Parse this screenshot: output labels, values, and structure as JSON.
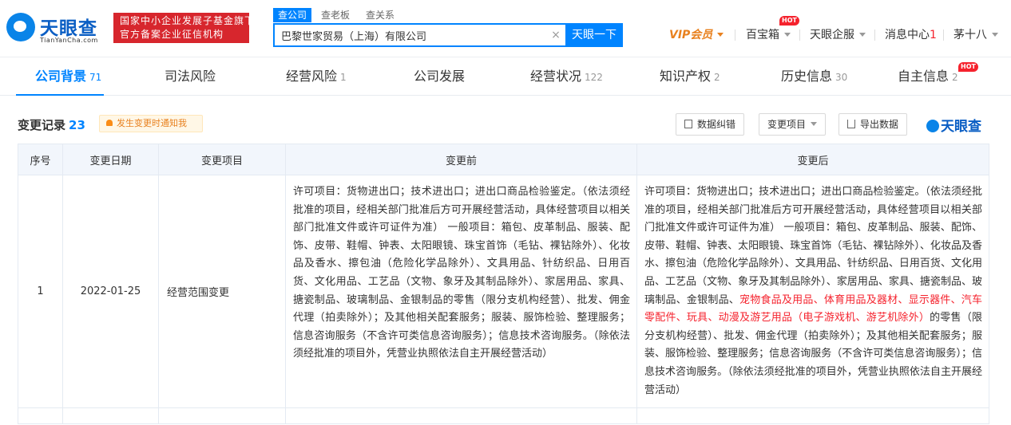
{
  "brand": {
    "name": "天眼查",
    "domain": "TianYanCha.com",
    "badge_line1": "国家中小企业发展子基金旗下",
    "badge_line2": "官方备案企业征信机构"
  },
  "search": {
    "tabs": [
      "查公司",
      "查老板",
      "查关系"
    ],
    "value": "巴黎世家贸易（上海）有限公司",
    "clear": "×",
    "button": "天眼一下"
  },
  "topnav": {
    "vip": "VIP会员",
    "treasure": "百宝箱",
    "enterprise": "天眼企服",
    "messages": "消息中心",
    "messages_count": "1",
    "user": "茅十八",
    "hot": "HOT"
  },
  "category_tabs": [
    {
      "label": "公司背景",
      "count": "71"
    },
    {
      "label": "司法风险",
      "count": ""
    },
    {
      "label": "经营风险",
      "count": "1"
    },
    {
      "label": "公司发展",
      "count": ""
    },
    {
      "label": "经营状况",
      "count": "122"
    },
    {
      "label": "知识产权",
      "count": "2"
    },
    {
      "label": "历史信息",
      "count": "30"
    },
    {
      "label": "自主信息",
      "count": "2"
    }
  ],
  "section": {
    "title": "变更记录",
    "count": "23",
    "notify": "发生变更时通知我",
    "btn_correct": "数据纠错",
    "btn_filter": "变更项目",
    "btn_export": "导出数据",
    "brand": "天眼查"
  },
  "table": {
    "headers": [
      "序号",
      "变更日期",
      "变更项目",
      "变更前",
      "变更后"
    ],
    "rows": [
      {
        "index": "1",
        "date": "2022-01-25",
        "item": "经营范围变更",
        "before": "许可项目：货物进出口；技术进出口；进出口商品检验鉴定。（依法须经批准的项目，经相关部门批准后方可开展经营活动，具体经营项目以相关部门批准文件或许可证件为准） 一般项目：箱包、皮革制品、服装、配饰、皮带、鞋帽、钟表、太阳眼镜、珠宝首饰（毛钻、裸钻除外）、化妆品及香水、擦包油（危险化学品除外）、文具用品、针纺织品、日用百货、文化用品、工艺品（文物、象牙及其制品除外）、家居用品、家具、搪瓷制品、玻璃制品、金银制品的零售（限分支机构经营）、批发、佣金代理（拍卖除外）；及其他相关配套服务；服装、服饰检验、整理服务；信息咨询服务（不含许可类信息咨询服务）；信息技术咨询服务。（除依法须经批准的项目外，凭营业执照依法自主开展经营活动）",
        "after_pre": "许可项目：货物进出口；技术进出口；进出口商品检验鉴定。（依法须经批准的项目，经相关部门批准后方可开展经营活动，具体经营项目以相关部门批准文件或许可证件为准） 一般项目：箱包、皮革制品、服装、配饰、皮带、鞋帽、钟表、太阳眼镜、珠宝首饰（毛钻、裸钻除外）、化妆品及香水、擦包油（危险化学品除外）、文具用品、针纺织品、日用百货、文化用品、工艺品（文物、象牙及其制品除外）、家居用品、家具、搪瓷制品、玻璃制品、金银制品、",
        "after_highlight": "宠物食品及用品、体育用品及器材、显示器件、汽车零配件、玩具、动漫及游艺用品（电子游戏机、游艺机除外）",
        "after_post": "的零售（限分支机构经营）、批发、佣金代理（拍卖除外）；及其他相关配套服务；服装、服饰检验、整理服务；信息咨询服务（不含许可类信息咨询服务）；信息技术咨询服务。（除依法须经批准的项目外，凭营业执照依法自主开展经营活动）"
      }
    ]
  },
  "colors": {
    "accent": "#0084ff",
    "brand_red": "#d7262d",
    "highlight": "#f5222d",
    "vip": "#e8811f"
  }
}
